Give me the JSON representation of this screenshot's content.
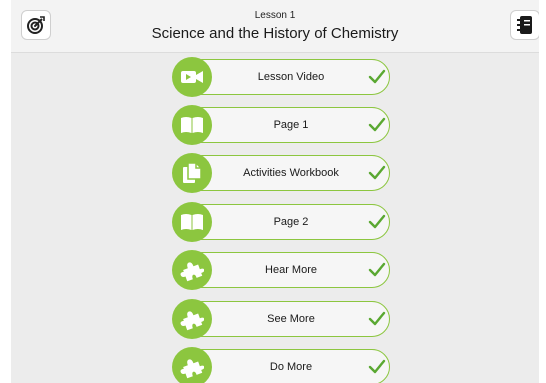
{
  "header": {
    "lesson_number": "Lesson 1",
    "title": "Science and the History of Chemistry",
    "left_icon": "target-icon",
    "right_icon": "notebook-icon"
  },
  "colors": {
    "accent_green": "#8cc63f",
    "check_green": "#5aa832"
  },
  "items": [
    {
      "label": "Lesson Video",
      "icon": "video-camera-icon",
      "completed": true
    },
    {
      "label": "Page 1",
      "icon": "book-icon",
      "completed": true
    },
    {
      "label": "Activities Workbook",
      "icon": "documents-icon",
      "completed": true
    },
    {
      "label": "Page 2",
      "icon": "book-icon",
      "completed": true
    },
    {
      "label": "Hear More",
      "icon": "puzzle-icon",
      "completed": true
    },
    {
      "label": "See More",
      "icon": "puzzle-icon",
      "completed": true
    },
    {
      "label": "Do More",
      "icon": "puzzle-icon",
      "completed": true
    }
  ]
}
